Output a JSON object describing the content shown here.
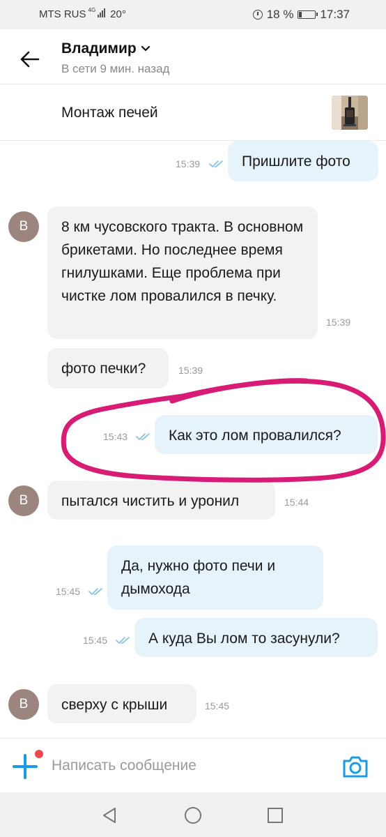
{
  "status_bar": {
    "carrier": "MTS RUS",
    "network": "4G",
    "temperature": "20°",
    "battery_percent": "18 %",
    "battery_level": 0.18,
    "time": "17:37"
  },
  "header": {
    "contact_name": "Владимир",
    "presence": "В сети 9 мин. назад"
  },
  "listing": {
    "title": "Монтаж печей"
  },
  "messages": [
    {
      "dir": "out",
      "text": "Пришлите фото",
      "time": "15:39",
      "read": true
    },
    {
      "dir": "in",
      "avatar": "В",
      "text": "8 км чусовского тракта. В основном брикетами. Но последнее время гнилушками. Еще проблема при чистке лом провалился в печку.",
      "time": "15:39"
    },
    {
      "dir": "in",
      "text": "фото печки?",
      "time": "15:39"
    },
    {
      "dir": "out",
      "text": "Как это лом провалился?",
      "time": "15:43",
      "read": true,
      "highlighted": true
    },
    {
      "dir": "in",
      "avatar": "В",
      "text": "пытался чистить и уронил",
      "time": "15:44"
    },
    {
      "dir": "out",
      "text": "Да, нужно фото печи и дымохода",
      "time": "15:45",
      "read": true
    },
    {
      "dir": "out",
      "text": "А куда Вы лом то засунули?",
      "time": "15:45",
      "read": true
    },
    {
      "dir": "in",
      "avatar": "В",
      "text": "сверху с крыши",
      "time": "15:45"
    }
  ],
  "composer": {
    "placeholder": "Написать сообщение",
    "has_notification_dot": true
  },
  "colors": {
    "accent": "#1a9be6",
    "incoming_bubble": "#f2f2f2",
    "outgoing_bubble": "#e6f3fb",
    "avatar": "#9c857f",
    "highlight_stroke": "#d81b74",
    "notification_dot": "#f04848"
  },
  "icons": {
    "back": "arrow-left-icon",
    "dropdown": "chevron-down-icon",
    "read": "double-check-icon",
    "attach": "plus-icon",
    "camera": "camera-icon",
    "nav_back": "triangle-back-icon",
    "nav_home": "circle-home-icon",
    "nav_recents": "square-recents-icon"
  }
}
